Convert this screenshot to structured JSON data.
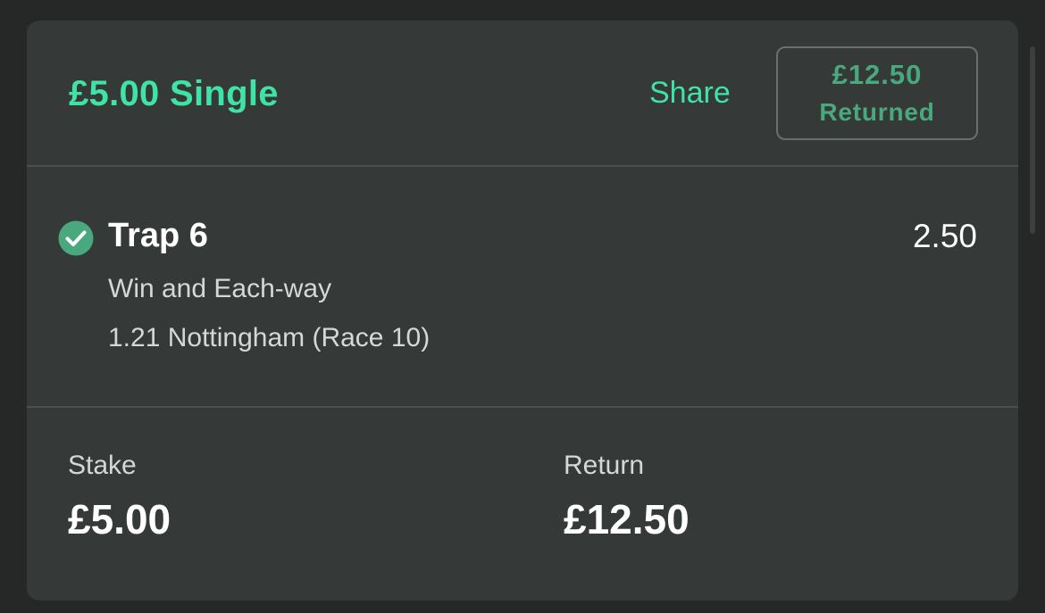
{
  "bet": {
    "title": "£5.00 Single",
    "share_label": "Share",
    "returned_amount": "£12.50",
    "returned_label": "Returned"
  },
  "selection": {
    "name": "Trap 6",
    "odds": "2.50",
    "market": "Win and Each-way",
    "event": "1.21 Nottingham (Race 10)",
    "status_icon": "check-circle-icon"
  },
  "summary": {
    "stake_label": "Stake",
    "stake_value": "£5.00",
    "return_label": "Return",
    "return_value": "£12.50"
  },
  "colors": {
    "accent": "#3fe3a6",
    "returned_text": "#4aa87f",
    "check_fill": "#4aa87f",
    "card_bg": "#353937",
    "page_bg": "#262827"
  }
}
